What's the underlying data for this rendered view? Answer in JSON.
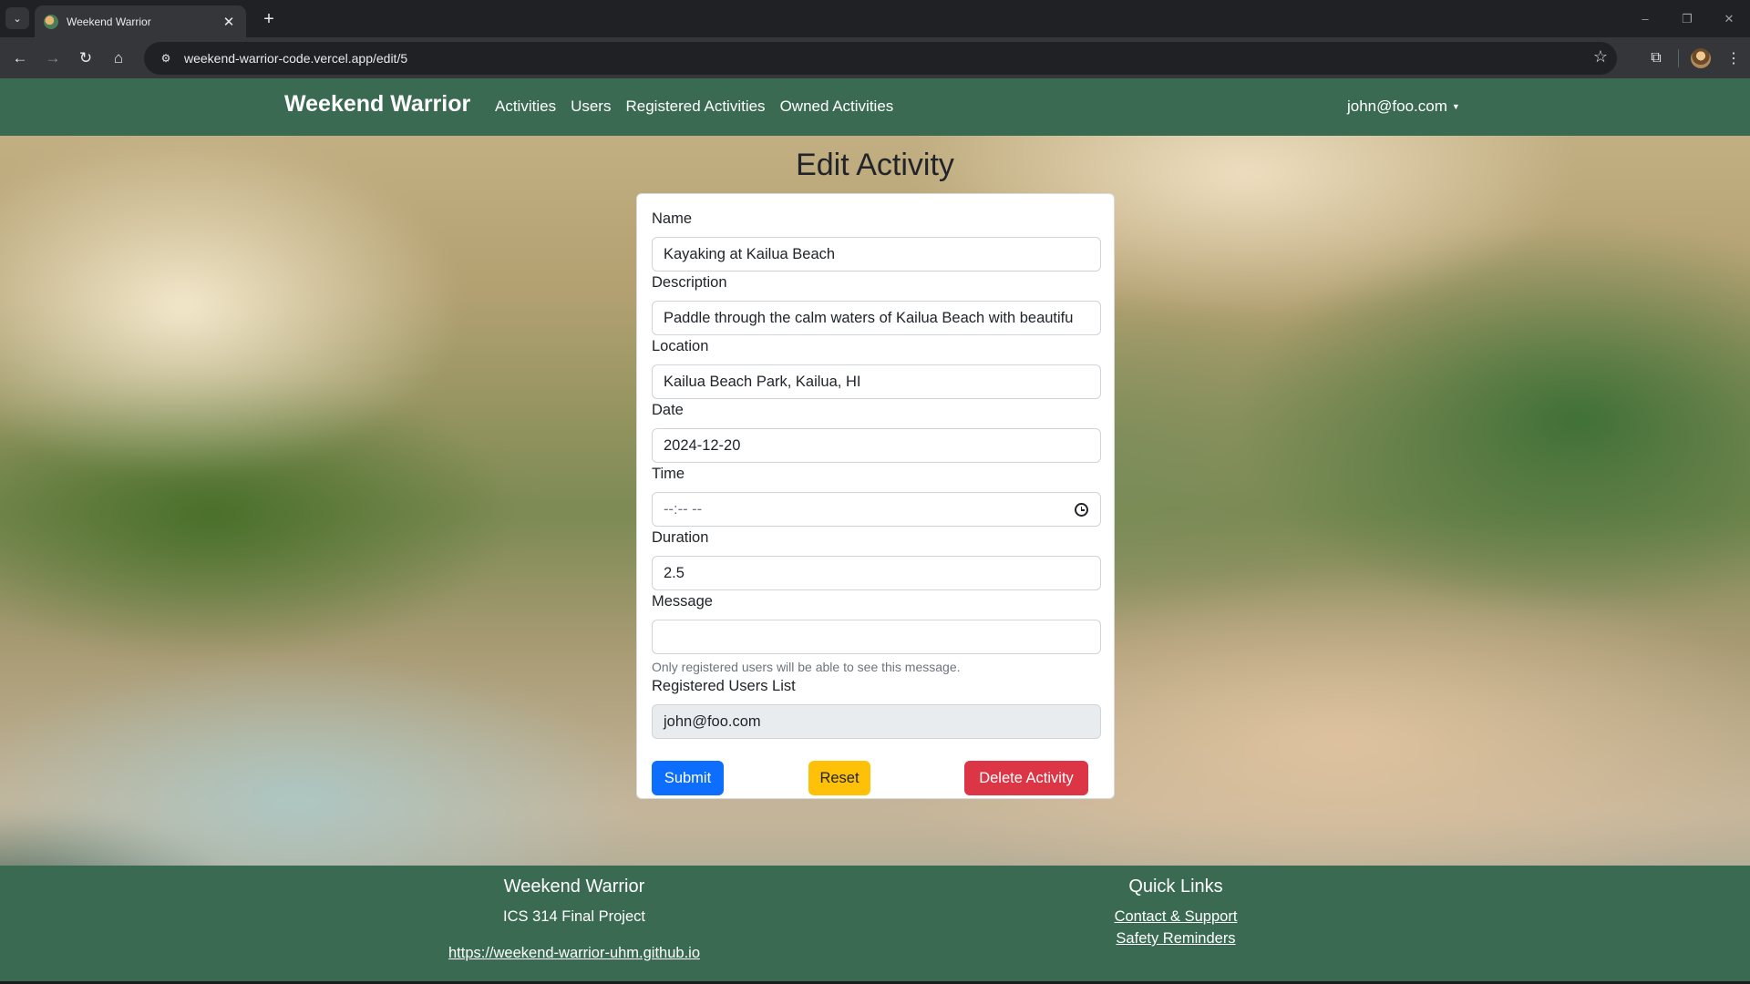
{
  "browser": {
    "tab_title": "Weekend Warrior",
    "tab_close": "✕",
    "new_tab": "+",
    "url": "weekend-warrior-code.vercel.app/edit/5",
    "window_controls": [
      "–",
      "❐",
      "✕"
    ]
  },
  "navbar": {
    "brand": "Weekend Warrior",
    "links": [
      "Activities",
      "Users",
      "Registered Activities",
      "Owned Activities"
    ],
    "user": "john@foo.com"
  },
  "page": {
    "title": "Edit Activity"
  },
  "form": {
    "name_label": "Name",
    "name_value": "Kayaking at Kailua Beach",
    "description_label": "Description",
    "description_value": "Paddle through the calm waters of Kailua Beach with beautifu",
    "location_label": "Location",
    "location_value": "Kailua Beach Park, Kailua, HI",
    "date_label": "Date",
    "date_value": "2024-12-20",
    "time_label": "Time",
    "time_placeholder": "--:-- --",
    "duration_label": "Duration",
    "duration_value": "2.5",
    "message_label": "Message",
    "message_value": "",
    "message_help": "Only registered users will be able to see this message.",
    "registered_label": "Registered Users List",
    "registered_value": "john@foo.com",
    "submit_label": "Submit",
    "reset_label": "Reset",
    "delete_label": "Delete Activity"
  },
  "footer": {
    "left_title": "Weekend Warrior",
    "left_subtitle": "ICS 314 Final Project",
    "left_link": "https://weekend-warrior-uhm.github.io",
    "right_title": "Quick Links",
    "right_link_1": "Contact & Support",
    "right_link_2": "Safety Reminders"
  },
  "colors": {
    "navbar": "#3a6b52",
    "primary": "#0d6efd",
    "warning": "#ffc107",
    "danger": "#dc3545"
  }
}
